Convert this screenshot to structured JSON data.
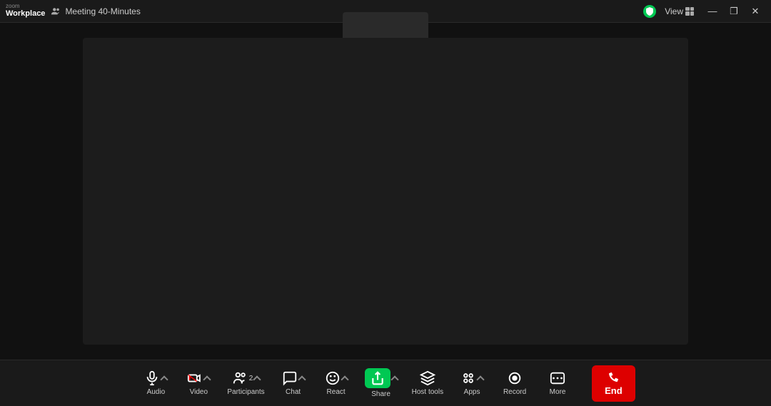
{
  "titlebar": {
    "app_name_small": "zoom",
    "app_name_large": "Workplace",
    "meeting_title": "Meeting 40-Minutes",
    "view_label": "View",
    "minimize_label": "—",
    "restore_label": "❐",
    "close_label": "✕"
  },
  "toolbar": {
    "audio_label": "Audio",
    "video_label": "Video",
    "participants_label": "Participants",
    "participants_count": "2",
    "chat_label": "Chat",
    "react_label": "React",
    "share_label": "Share",
    "host_tools_label": "Host tools",
    "apps_label": "Apps",
    "record_label": "Record",
    "more_label": "More",
    "end_label": "End"
  }
}
